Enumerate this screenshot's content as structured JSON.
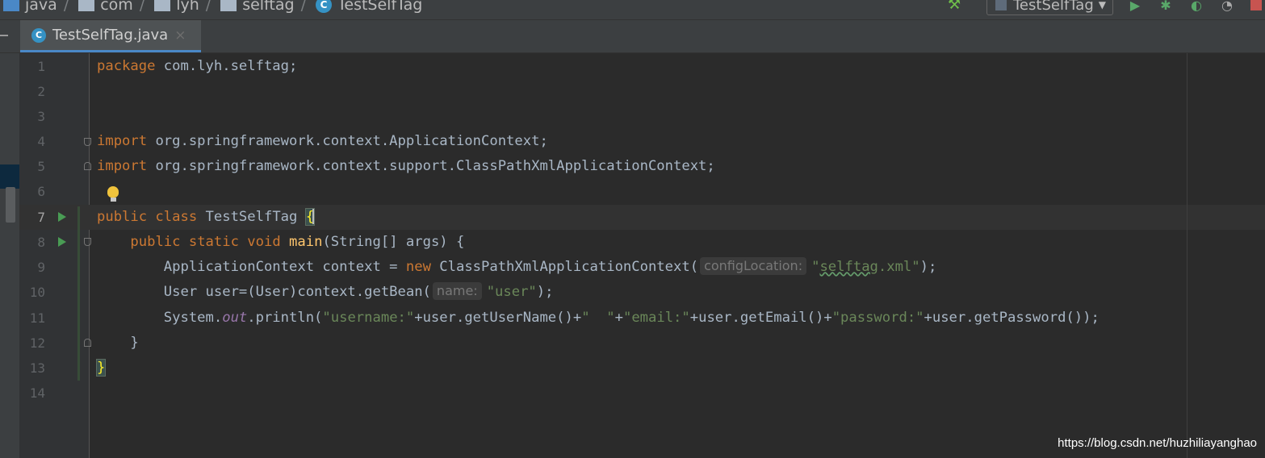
{
  "breadcrumbs": [
    "java",
    "com",
    "lyh",
    "selftag",
    "TestSelfTag"
  ],
  "toolbar": {
    "run_config": "TestSelfTag"
  },
  "tab": {
    "label": "TestSelfTag.java",
    "close": "×"
  },
  "editor": {
    "line_numbers": [
      "1",
      "2",
      "3",
      "4",
      "5",
      "6",
      "7",
      "8",
      "9",
      "10",
      "11",
      "12",
      "13",
      "14"
    ],
    "lines": {
      "l1": [
        "package",
        " com.lyh.selftag;"
      ],
      "l4": [
        "import",
        " org.springframework.context.ApplicationContext;"
      ],
      "l5": [
        "import",
        " org.springframework.context.support.ClassPathXmlApplicationContext;"
      ],
      "l7": [
        "public class",
        " TestSelfTag ",
        "{"
      ],
      "l8": [
        "    ",
        "public static void",
        " ",
        "main",
        "(String[] args) {"
      ],
      "l9": [
        "        ApplicationContext context = ",
        "new",
        " ClassPathXmlApplicationContext(",
        "configLocation:",
        "\"",
        "selftag",
        ".xml\"",
        ");"
      ],
      "l10": [
        "        User user=(User)context.getBean(",
        "name:",
        "\"user\"",
        ");"
      ],
      "l11": [
        "        System.",
        "out",
        ".println(",
        "\"username:\"",
        "+user.getUserName()+",
        "\"  \"",
        "+",
        "\"email:\"",
        "+user.getEmail()+",
        "\"password:\"",
        "+user.getPassword());"
      ],
      "l12": [
        "    }"
      ],
      "l13": [
        "}"
      ]
    }
  },
  "watermark": "https://blog.csdn.net/huzhiliayanghao",
  "colors": {
    "keyword": "#cc7832",
    "string": "#6a8759",
    "method": "#ffc66d",
    "static_field": "#9876aa",
    "plain": "#a9b7c6",
    "background": "#2b2b2b"
  }
}
